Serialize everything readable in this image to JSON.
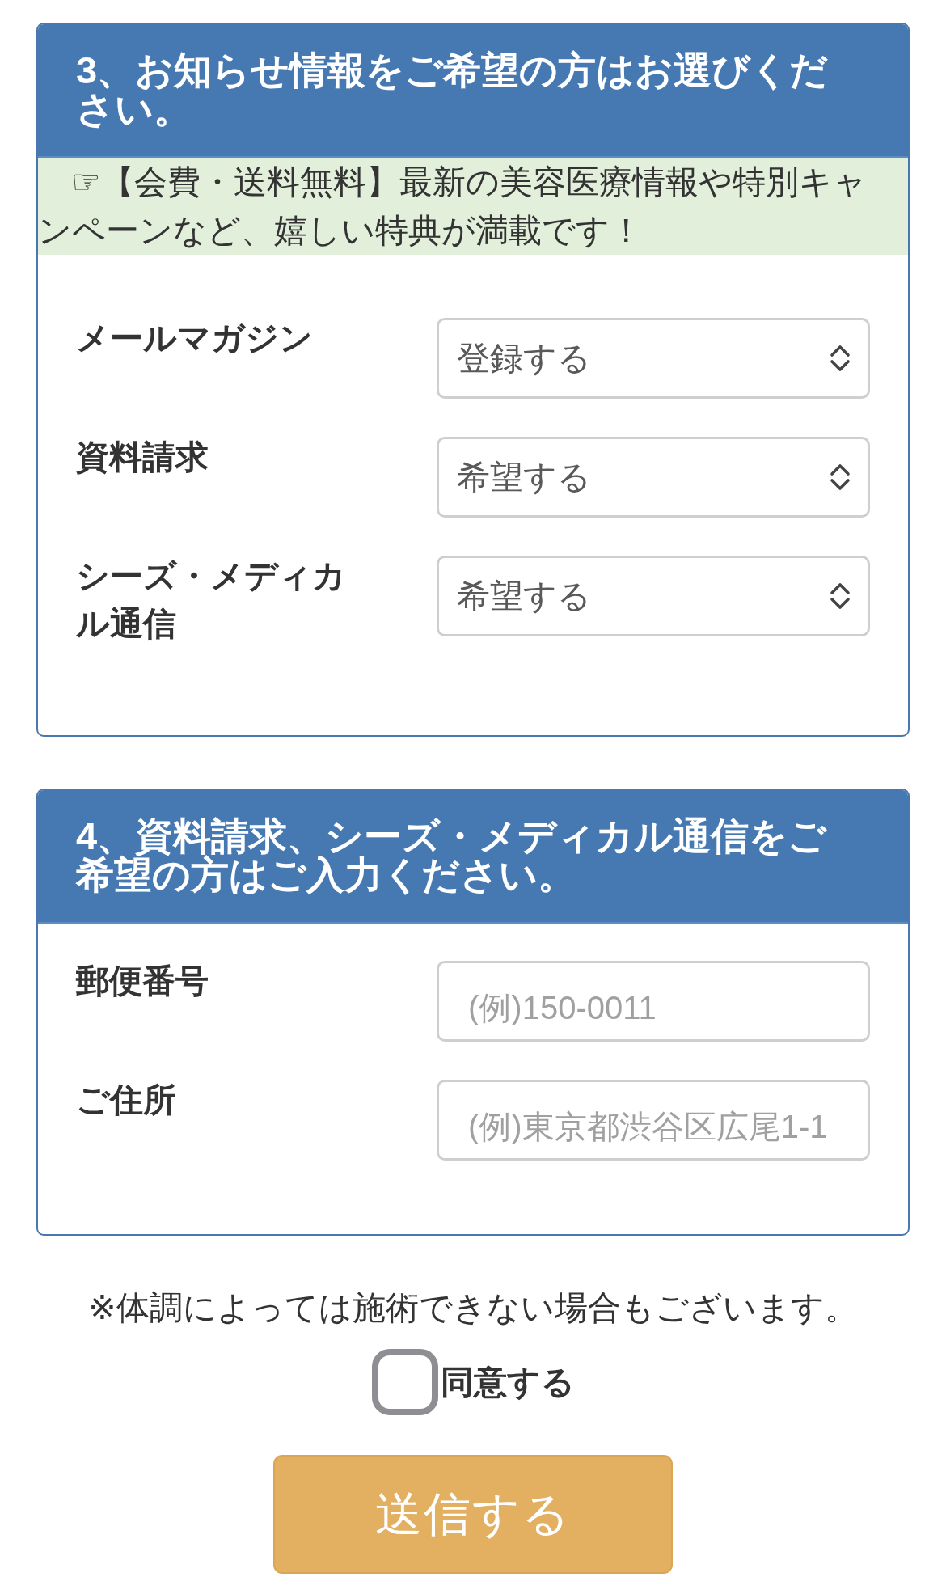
{
  "sections": [
    {
      "title": "3、お知らせ情報をご希望の方はお選びください。",
      "notice": "☞【会費・送料無料】最新の美容医療情報や特別キャンペーンなど、嬉しい特典が満載です！",
      "fields": [
        {
          "kind": "select",
          "label": "メールマガジン",
          "value": "登録する"
        },
        {
          "kind": "select",
          "label": "資料請求",
          "value": "希望する"
        },
        {
          "kind": "select",
          "label": "シーズ・メディカル通信",
          "value": "希望する"
        }
      ]
    },
    {
      "title": "4、資料請求、シーズ・メディカル通信をご希望の方はご入力ください。",
      "fields": [
        {
          "kind": "text",
          "label": "郵便番号",
          "placeholder": "(例)150-0011"
        },
        {
          "kind": "text",
          "label": "ご住所",
          "placeholder": "(例)東京都渋谷区広尾1-1"
        }
      ]
    }
  ],
  "note": "※体調によっては施術できない場合もございます。",
  "agreement": {
    "label": "同意する",
    "checked": false
  },
  "submit_button": "送信する"
}
